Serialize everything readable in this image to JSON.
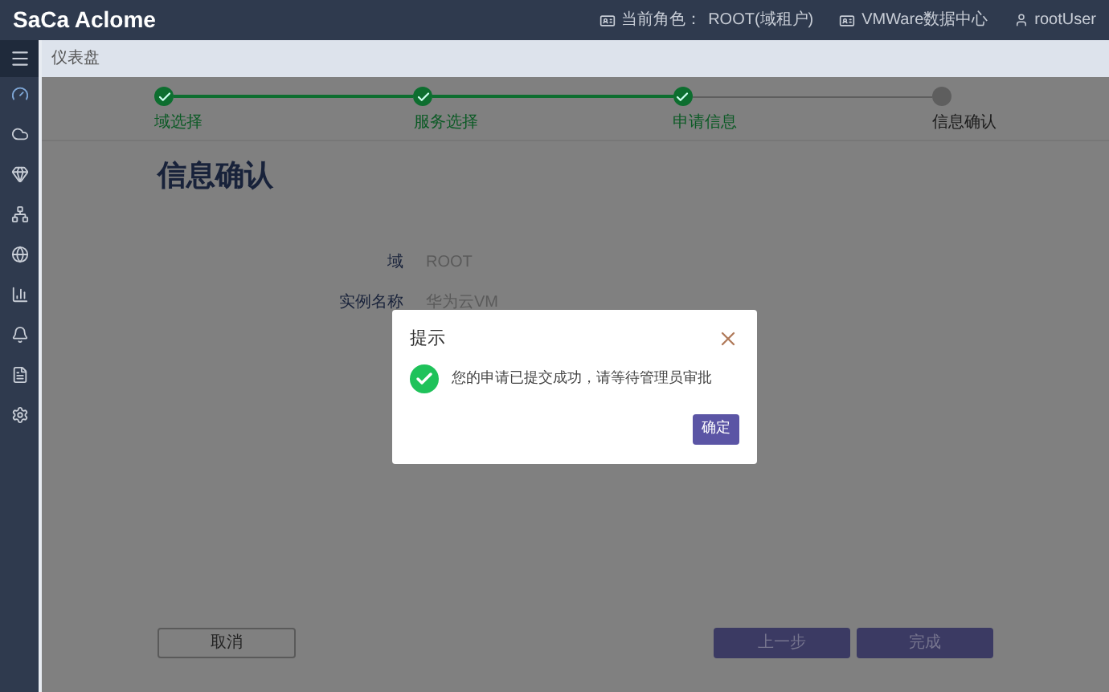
{
  "header": {
    "logo": "SaCa Aclome",
    "role_label": "当前角色：",
    "role": "ROOT(域租户)",
    "datacenter": "VMWare数据中心",
    "user": "rootUser"
  },
  "breadcrumb": "仪表盘",
  "steps": [
    {
      "label": "域选择",
      "done": true
    },
    {
      "label": "服务选择",
      "done": true
    },
    {
      "label": "申请信息",
      "done": true
    },
    {
      "label": "信息确认",
      "done": false
    }
  ],
  "title": "信息确认",
  "fields": [
    {
      "label": "域",
      "value": "ROOT"
    },
    {
      "label": "实例名称",
      "value": "华为云VM"
    }
  ],
  "dialog": {
    "title": "提示",
    "message": "您的申请已提交成功，请等待管理员审批",
    "button": "确定"
  },
  "buttons": {
    "cancel": "取消",
    "prev": "上一步",
    "finish": "完成"
  }
}
